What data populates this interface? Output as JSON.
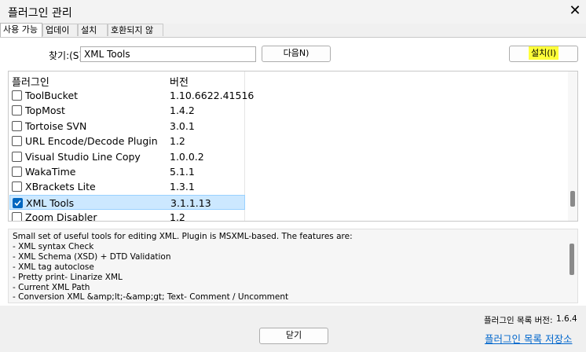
{
  "window": {
    "title": "플러그인 관리",
    "close_glyph": "✕"
  },
  "tabs": [
    {
      "label": "사용 가능",
      "active": true
    },
    {
      "label": "업데이트",
      "active": false
    },
    {
      "label": "설치됨",
      "active": false
    },
    {
      "label": "호환되지 않음",
      "active": false
    }
  ],
  "search": {
    "label": "찾기:(S)",
    "value": "XML Tools"
  },
  "buttons": {
    "next": "다음N)",
    "install": "설치(I)",
    "close": "닫기"
  },
  "list": {
    "columns": {
      "name": "플러그인",
      "version": "버전"
    },
    "rows": [
      {
        "name": "ToolBucket",
        "version": "1.10.6622.41516",
        "checked": false
      },
      {
        "name": "TopMost",
        "version": "1.4.2",
        "checked": false
      },
      {
        "name": "Tortoise SVN",
        "version": "3.0.1",
        "checked": false
      },
      {
        "name": "URL Encode/Decode Plugin",
        "version": "1.2",
        "checked": false
      },
      {
        "name": "Visual Studio Line Copy",
        "version": "1.0.0.2",
        "checked": false
      },
      {
        "name": "WakaTime",
        "version": "5.1.1",
        "checked": false
      },
      {
        "name": "XBrackets Lite",
        "version": "1.3.1",
        "checked": false
      },
      {
        "name": "XML Tools",
        "version": "3.1.1.13",
        "checked": true,
        "selected": true
      },
      {
        "name": "Zoom Disabler",
        "version": "1.2",
        "checked": false
      }
    ]
  },
  "description": {
    "lines": [
      "Small set of useful tools for editing XML. Plugin is MSXML-based. The features are:",
      "- XML syntax Check",
      "- XML Schema (XSD) + DTD Validation",
      "- XML tag autoclose",
      "- Pretty print- Linarize XML",
      "- Current XML Path",
      "- Conversion XML &amp;lt;-&amp;gt; Text- Comment / Uncomment"
    ]
  },
  "footer": {
    "version_label": "플러그인 목록 버전:",
    "version_value": "1.6.4",
    "link": "플러그인 목록 저장소"
  },
  "colors": {
    "selection": "#cce8ff",
    "check": "#0067c0",
    "highlight": "#ffff3a",
    "link": "#0066cc"
  }
}
